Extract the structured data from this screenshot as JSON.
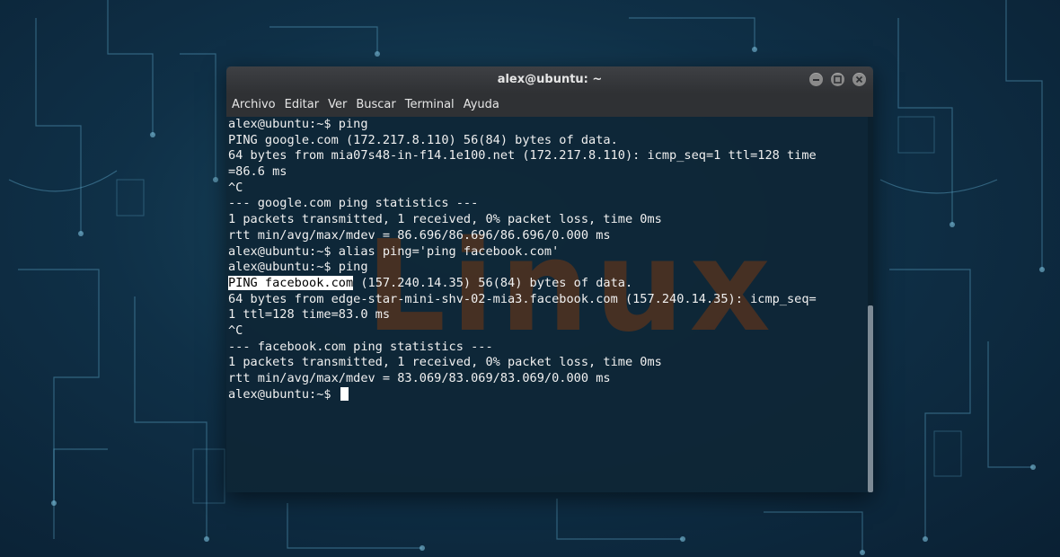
{
  "window": {
    "title": "alex@ubuntu: ~",
    "controls": {
      "minimize": "minimize-icon",
      "maximize": "maximize-icon",
      "close": "close-icon"
    }
  },
  "menu": [
    "Archivo",
    "Editar",
    "Ver",
    "Buscar",
    "Terminal",
    "Ayuda"
  ],
  "watermark": "Linux",
  "colors": {
    "terminal_bg": "#0e2636",
    "text": "#f0f0f0",
    "watermark": "#8c3c0a"
  },
  "terminal": {
    "lines": [
      "alex@ubuntu:~$ ping",
      "PING google.com (172.217.8.110) 56(84) bytes of data.",
      "64 bytes from mia07s48-in-f14.1e100.net (172.217.8.110): icmp_seq=1 ttl=128 time",
      "=86.6 ms",
      "^C",
      "--- google.com ping statistics ---",
      "1 packets transmitted, 1 received, 0% packet loss, time 0ms",
      "rtt min/avg/max/mdev = 86.696/86.696/86.696/0.000 ms",
      "alex@ubuntu:~$ alias ping='ping facebook.com'",
      "alex@ubuntu:~$ ping"
    ],
    "highlight_line": {
      "selected": "PING facebook.com",
      "rest": " (157.240.14.35) 56(84) bytes of data."
    },
    "lines2": [
      "64 bytes from edge-star-mini-shv-02-mia3.facebook.com (157.240.14.35): icmp_seq=",
      "1 ttl=128 time=83.0 ms",
      "^C",
      "--- facebook.com ping statistics ---",
      "1 packets transmitted, 1 received, 0% packet loss, time 0ms",
      "rtt min/avg/max/mdev = 83.069/83.069/83.069/0.000 ms"
    ],
    "prompt": "alex@ubuntu:~$ "
  }
}
